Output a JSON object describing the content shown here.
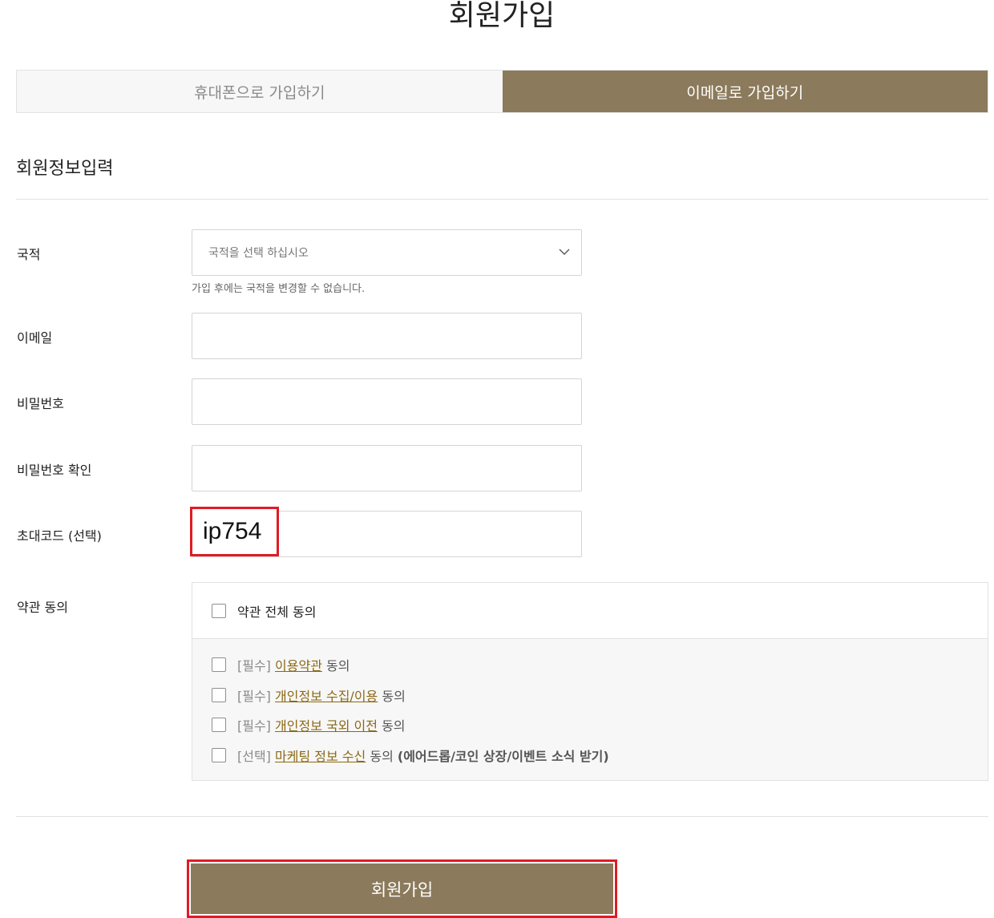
{
  "page_title": "회원가입",
  "tabs": [
    {
      "label": "휴대폰으로 가입하기",
      "active": false
    },
    {
      "label": "이메일로 가입하기",
      "active": true
    }
  ],
  "section_title": "회원정보입력",
  "form": {
    "nationality": {
      "label": "국적",
      "placeholder": "국적을 선택 하십시오",
      "hint": "가입 후에는 국적을 변경할 수 없습니다."
    },
    "email": {
      "label": "이메일",
      "value": ""
    },
    "password": {
      "label": "비밀번호",
      "value": ""
    },
    "password_confirm": {
      "label": "비밀번호 확인",
      "value": ""
    },
    "invite_code": {
      "label": "초대코드 (선택)",
      "value": "ip754"
    },
    "terms": {
      "label": "약관 동의",
      "all_label": "약관 전체 동의",
      "items": [
        {
          "tag": "[필수]",
          "link": "이용약관",
          "suffix": "동의",
          "extra": ""
        },
        {
          "tag": "[필수]",
          "link": "개인정보 수집/이용",
          "suffix": "동의",
          "extra": ""
        },
        {
          "tag": "[필수]",
          "link": "개인정보 국외 이전",
          "suffix": "동의",
          "extra": ""
        },
        {
          "tag": "[선택]",
          "link": "마케팅 정보 수신",
          "suffix": "동의",
          "extra": "(에어드롭/코인 상장/이벤트 소식 받기)"
        }
      ]
    }
  },
  "submit_label": "회원가입",
  "colors": {
    "accent": "#8b7a5b",
    "link": "#8b6914",
    "highlight_border": "#e01b24"
  }
}
